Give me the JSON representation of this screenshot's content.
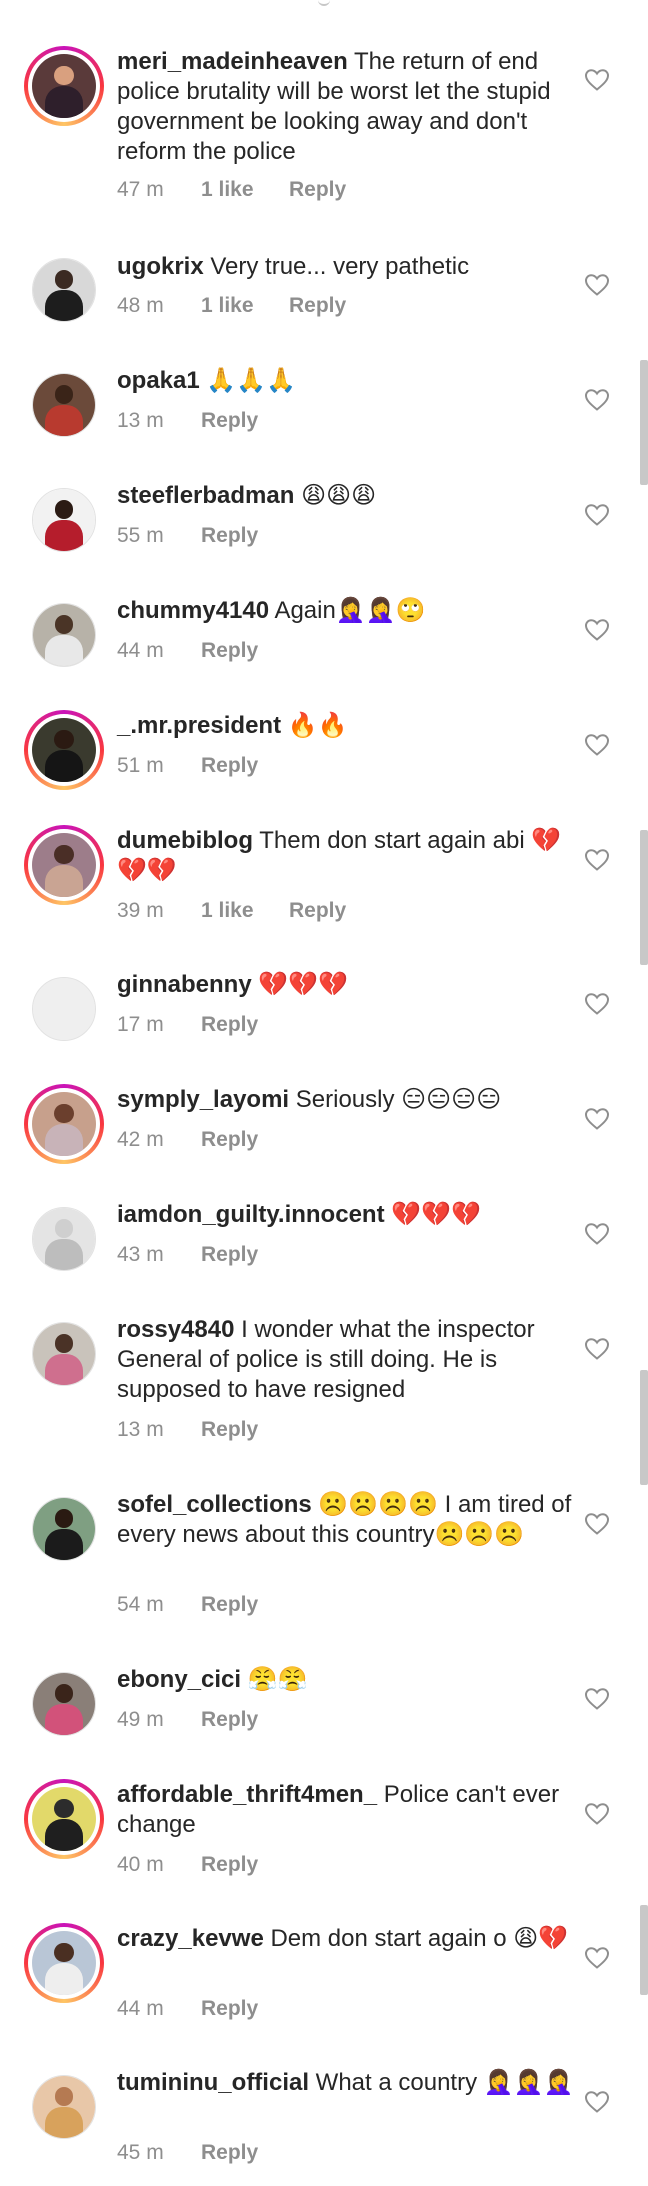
{
  "comments": [
    {
      "username": "meri_madeinheaven",
      "text": " The return of end police brutality will be worst let the stupid government be looking away and don't reform the police",
      "time": "47 m",
      "likes": "1 like",
      "reply": "Reply",
      "story_ring": true,
      "avatar": {
        "bg": "#5a3a3a",
        "head": "#d9a07f",
        "body": "#2e1f2b"
      }
    },
    {
      "username": "ugokrix",
      "text": " Very true... very pathetic",
      "time": "48 m",
      "likes": "1 like",
      "reply": "Reply",
      "story_ring": false,
      "avatar": {
        "bg": "#d8d8d8",
        "head": "#3b2a22",
        "body": "#1d1d1d"
      }
    },
    {
      "username": "opaka1",
      "text": " 🙏🙏🙏",
      "time": "13 m",
      "likes": "",
      "reply": "Reply",
      "story_ring": false,
      "avatar": {
        "bg": "#6b4a3a",
        "head": "#3a2418",
        "body": "#b83a2f"
      }
    },
    {
      "username": "steeflerbadman",
      "text": " 😩😩😩",
      "time": "55 m",
      "likes": "",
      "reply": "Reply",
      "story_ring": false,
      "avatar": {
        "bg": "#f2f2f2",
        "head": "#2b1b14",
        "body": "#b51d2c"
      }
    },
    {
      "username": "chummy4140",
      "text": " Again🤦‍♀️🤦‍♀️🙄",
      "time": "44 m",
      "likes": "",
      "reply": "Reply",
      "story_ring": false,
      "avatar": {
        "bg": "#b7b2a8",
        "head": "#4a3426",
        "body": "#e8e8e8"
      }
    },
    {
      "username": "_.mr.president",
      "text": " 🔥🔥",
      "time": "51 m",
      "likes": "",
      "reply": "Reply",
      "story_ring": true,
      "avatar": {
        "bg": "#3a3a2e",
        "head": "#2b1a12",
        "body": "#151515"
      }
    },
    {
      "username": "dumebiblog",
      "text": " Them don start again abi 💔💔💔",
      "time": "39 m",
      "likes": "1 like",
      "reply": "Reply",
      "story_ring": true,
      "avatar": {
        "bg": "#9d7d8a",
        "head": "#4a2e26",
        "body": "#c9a493"
      }
    },
    {
      "username": "ginnabenny",
      "text": " 💔💔💔",
      "time": "17 m",
      "likes": "",
      "reply": "Reply",
      "story_ring": false,
      "avatar": {
        "bg": "#efefef",
        "head": "#efefef",
        "body": "#efefef"
      }
    },
    {
      "username": "symply_layomi",
      "text": " Seriously 😑😑😑😑",
      "time": "42 m",
      "likes": "",
      "reply": "Reply",
      "story_ring": true,
      "avatar": {
        "bg": "#c7a08c",
        "head": "#6b3f2d",
        "body": "#c8b3b8"
      }
    },
    {
      "username": "iamdon_guilty.innocent",
      "text": " 💔💔💔",
      "time": "43 m",
      "likes": "",
      "reply": "Reply",
      "story_ring": false,
      "avatar": {
        "bg": "#e4e4e4",
        "head": "#cfcfcf",
        "body": "#bdbdbd"
      }
    },
    {
      "username": "rossy4840",
      "text": " I wonder what the inspector General of police is still doing. He is supposed to have resigned",
      "time": "13 m",
      "likes": "",
      "reply": "Reply",
      "story_ring": false,
      "avatar": {
        "bg": "#c9c3bb",
        "head": "#4a3226",
        "body": "#cf6f8e"
      }
    },
    {
      "username": "sofel_collections",
      "text": " ☹️☹️☹️☹️ I am tired of every news about this country☹️☹️☹️",
      "time": "54 m",
      "likes": "",
      "reply": "Reply",
      "story_ring": false,
      "avatar": {
        "bg": "#7f9f82",
        "head": "#2a1a12",
        "body": "#1b1b1b"
      }
    },
    {
      "username": "ebony_cici",
      "text": " 😤😤",
      "time": "49 m",
      "likes": "",
      "reply": "Reply",
      "story_ring": false,
      "avatar": {
        "bg": "#8a7f78",
        "head": "#3a241a",
        "body": "#d2527a"
      }
    },
    {
      "username": "affordable_thrift4men_",
      "text": " Police can't ever change",
      "time": "40 m",
      "likes": "",
      "reply": "Reply",
      "story_ring": true,
      "avatar": {
        "bg": "#e2d96a",
        "head": "#2c2c2c",
        "body": "#1f1f1f"
      }
    },
    {
      "username": "crazy_kevwe",
      "text": " Dem don start again o 😩💔",
      "time": "44 m",
      "likes": "",
      "reply": "Reply",
      "story_ring": true,
      "avatar": {
        "bg": "#b9c6d6",
        "head": "#4a2f22",
        "body": "#eeeeee"
      }
    },
    {
      "username": "tumininu_official",
      "text": " What a country 🤦‍♀️🤦‍♀️🤦‍♀️",
      "time": "45 m",
      "likes": "",
      "reply": "Reply",
      "story_ring": false,
      "avatar": {
        "bg": "#e8c7a8",
        "head": "#b57a52",
        "body": "#d8a25c"
      }
    }
  ]
}
